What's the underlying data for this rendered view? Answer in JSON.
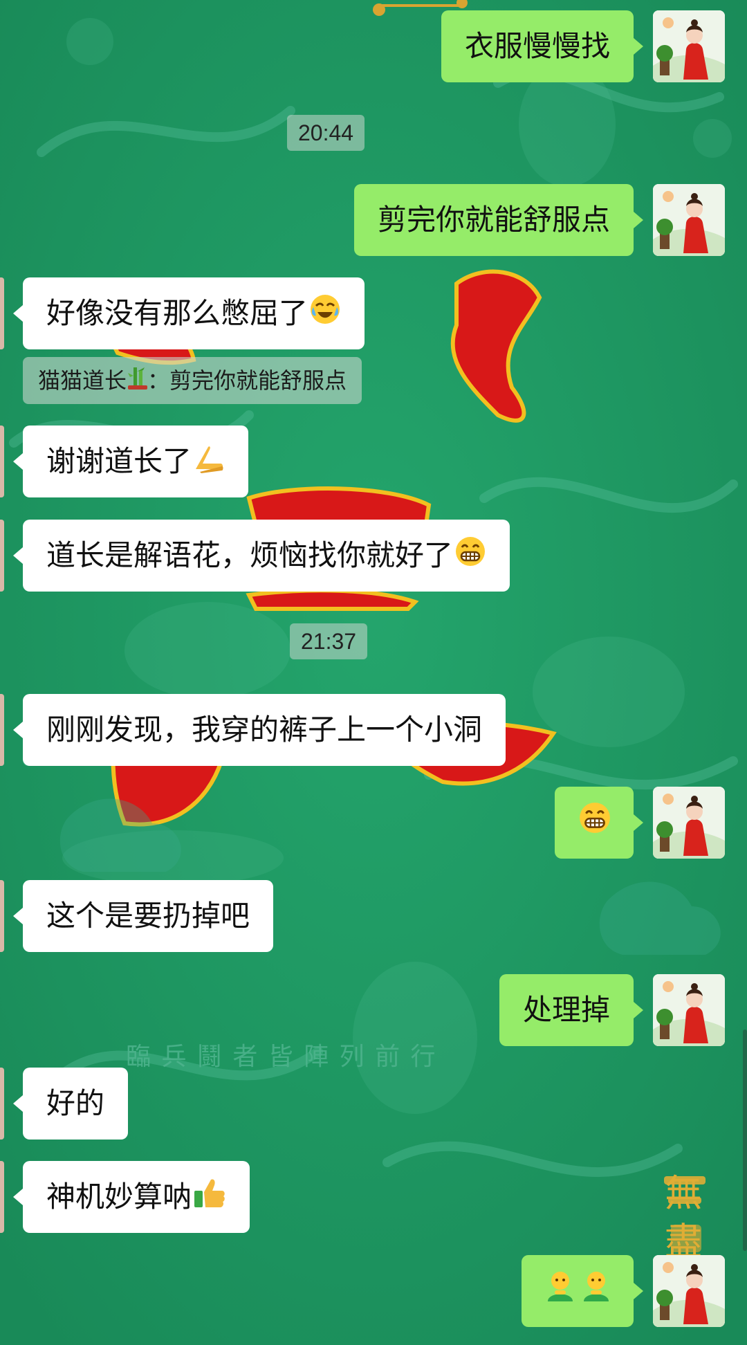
{
  "colors": {
    "background": "#1f9a64",
    "outgoing_bubble": "#95ec69",
    "incoming_bubble": "#ffffff",
    "timestamp_bg": "#c8d7cd"
  },
  "background_text": {
    "motto": "臨 兵 鬪 者 皆 陣 列 前 行",
    "corner": "無盡"
  },
  "messages": [
    {
      "side": "right",
      "text": "衣服慢慢找"
    },
    {
      "type": "time",
      "text": "20:44"
    },
    {
      "side": "right",
      "text": "剪完你就能舒服点"
    },
    {
      "side": "left",
      "text": "好像没有那么憋屈了",
      "emoji": "crying-laughing-emoji"
    },
    {
      "type": "quote",
      "text": "猫猫道长",
      "emoji": "bamboo-emoji",
      "text2": "：剪完你就能舒服点"
    },
    {
      "side": "left",
      "text": "谢谢道长了",
      "emoji": "praying-hands-emoji"
    },
    {
      "side": "left",
      "text": "道长是解语花，烦恼找你就好了",
      "emoji": "grinning-emoji"
    },
    {
      "type": "time",
      "text": "21:37"
    },
    {
      "side": "left",
      "text": "刚刚发现，我穿的裤子上一个小洞"
    },
    {
      "side": "right",
      "text": "",
      "emoji": "grinning-emoji"
    },
    {
      "side": "left",
      "text": "这个是要扔掉吧"
    },
    {
      "side": "right",
      "text": "处理掉"
    },
    {
      "side": "left",
      "text": "好的"
    },
    {
      "side": "left",
      "text": "神机妙算呐",
      "emoji": "thumbs-up-emoji"
    },
    {
      "side": "right",
      "text": "",
      "emoji": "two-people-emoji"
    }
  ]
}
